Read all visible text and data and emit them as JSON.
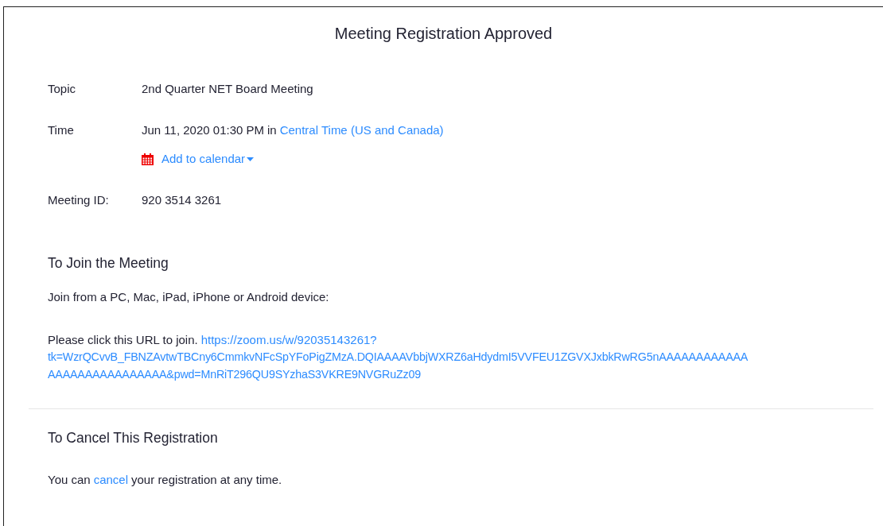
{
  "title": "Meeting Registration Approved",
  "details": [
    {
      "label": "Topic",
      "value": "2nd Quarter NET Board Meeting"
    },
    {
      "label": "Time",
      "value": "Jun 11, 2020 01:30 PM",
      "connector": "in",
      "link": "Central Time (US and Canada)",
      "calendar": "Add to calendar"
    },
    {
      "label": "Meeting ID:",
      "value": "920 3514 3261"
    }
  ],
  "join": {
    "heading": "To Join the Meeting",
    "devices": "Join from a PC, Mac, iPad, iPhone or Android device:",
    "prompt": "Please click this URL to join.",
    "url_lines": [
      "https://zoom.us/w/92035143261?",
      "tk=WzrQCvvB_FBNZAvtwTBCny6CmmkvNFcSpYFoPigZMzA.DQIAAAAVbbjWXRZ6aHdydmI5VVFEU1ZGVXJxbkRwRG5nAAAAAAAAAAAA",
      "AAAAAAAAAAAAAAAA&pwd=MnRiT296QU9SYzhaS3VKRE9NVGRuZz09"
    ]
  },
  "cancel": {
    "heading": "To Cancel This Registration",
    "before": "You can",
    "link": "cancel",
    "after": "your registration at any time."
  }
}
